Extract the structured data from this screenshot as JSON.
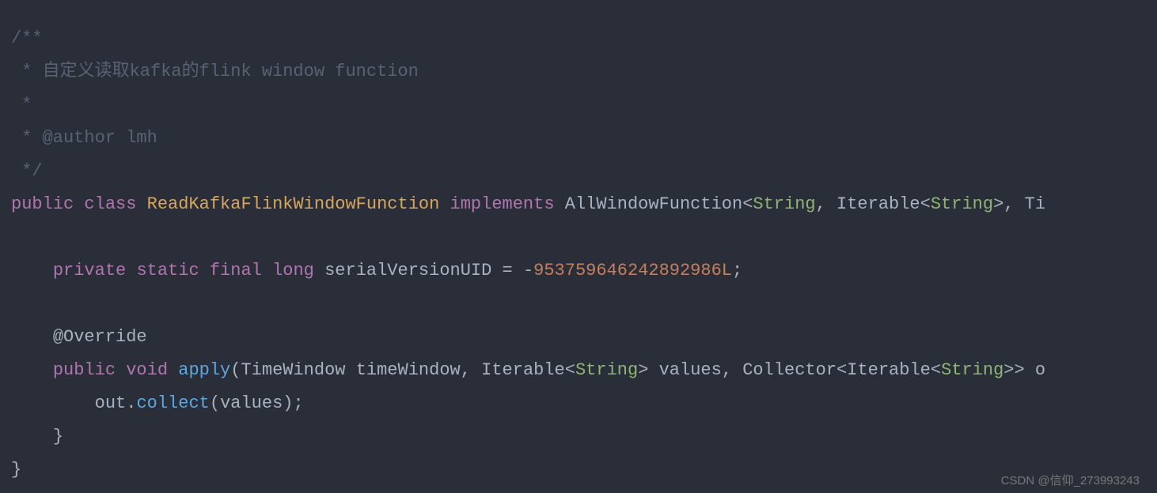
{
  "code": {
    "l1": "/**",
    "l2": " * 自定义读取kafka的flink window function",
    "l3": " *",
    "l4": " * @author lmh",
    "l5": " */",
    "kw_public": "public",
    "kw_class": "class",
    "className": "ReadKafkaFlinkWindowFunction",
    "kw_implements": "implements",
    "iface": "AllWindowFunction",
    "lt": "<",
    "gt": ">",
    "type_String": "String",
    "comma": ", ",
    "type_Iterable": "Iterable",
    "type_TimeWindow_partial": "Ti",
    "spc4": "    ",
    "spc8": "        ",
    "kw_private": "private",
    "kw_static": "static",
    "kw_final": "final",
    "kw_long": "long",
    "field_name": "serialVersionUID",
    "eq": " = ",
    "neg": "-",
    "serialNum": "953759646242892986L",
    "semi": ";",
    "ann_override": "@Override",
    "kw_void": "void",
    "fn_apply": "apply",
    "paren_open": "(",
    "paren_close": ")",
    "brace_open": " {",
    "brace_close": "}",
    "type_TimeWindow": "TimeWindow",
    "param_timeWindow": " timeWindow",
    "param_values": " values",
    "type_Collector": "Collector",
    "param_out_partial": " o",
    "stmt_out": "out",
    "dot": ".",
    "fn_collect": "collect",
    "arg_values": "values",
    "dbl_gt": ">>"
  },
  "watermark": "CSDN @信仰_273993243"
}
